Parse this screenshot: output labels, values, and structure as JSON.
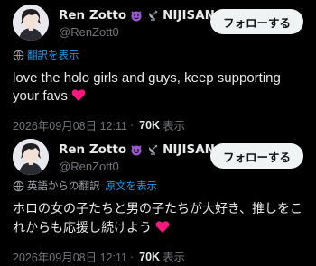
{
  "tweets": [
    {
      "author_name": "Ren Zotto",
      "author_suffix": "NIJISAN...",
      "handle": "@RenZott0",
      "follow_label": "フォローする",
      "translate_link": "翻訳を表示",
      "body": "love the holo girls and guys, keep supporting your favs",
      "timestamp": "2026年09月08日 12:11",
      "views": "70K",
      "views_label": "表示"
    },
    {
      "author_name": "Ren Zotto",
      "author_suffix": "NIJISAN...",
      "handle": "@RenZott0",
      "follow_label": "フォローする",
      "translated_from": "英語からの翻訳",
      "show_original": "原文を表示",
      "body": "ホロの女の子たちと男の子たちが大好き、推しをこれからも応援し続けよう",
      "timestamp": "2026年09月08日 12:11",
      "views": "70K",
      "views_label": "表示"
    }
  ],
  "colors": {
    "background": "#000000",
    "accent_link": "#1d9bf0",
    "verified_badge": "#1d9bf0",
    "heart": "#f91880",
    "muted_text": "#71767b"
  },
  "icons": [
    "smiling-devil-emoji",
    "satellite-dish-emoji",
    "verified-badge-icon",
    "translate-globe-icon",
    "red-heart-emoji"
  ]
}
